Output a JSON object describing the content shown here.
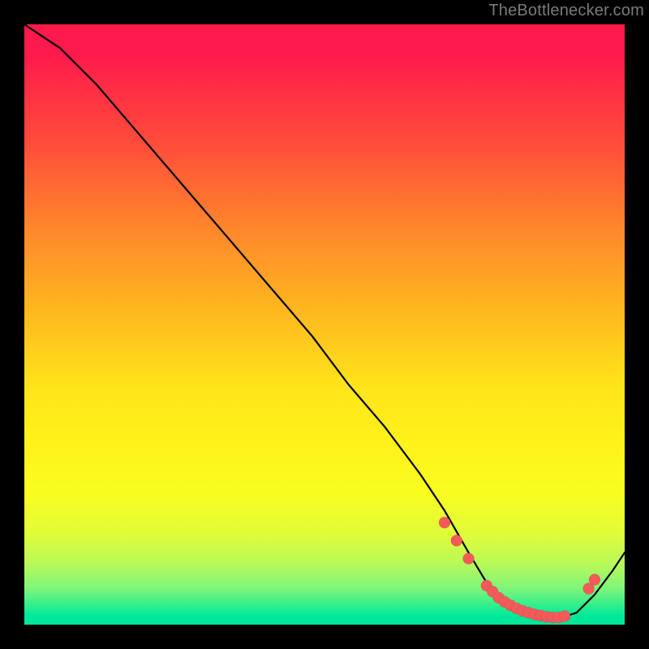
{
  "attribution": "TheBottlenecker.com",
  "chart_data": {
    "type": "line",
    "title": "",
    "xlabel": "",
    "ylabel": "",
    "xlim": [
      0,
      100
    ],
    "ylim": [
      0,
      100
    ],
    "x": [
      0,
      6,
      12,
      18,
      24,
      30,
      36,
      42,
      48,
      54,
      60,
      66,
      70,
      74,
      77,
      80,
      83,
      86,
      89,
      92,
      95,
      98,
      100
    ],
    "values": [
      100,
      96,
      90,
      83,
      76,
      69,
      62,
      55,
      48,
      40,
      33,
      25,
      19,
      12,
      7,
      4,
      2,
      1,
      1,
      2,
      5,
      9,
      12
    ],
    "markers": {
      "x": [
        70,
        72,
        74,
        77,
        78,
        79,
        80,
        81,
        82,
        83,
        84,
        85,
        86,
        87,
        88,
        89,
        90,
        94,
        95
      ],
      "y": [
        17,
        14,
        11,
        6.5,
        5.5,
        4.5,
        3.8,
        3.2,
        2.7,
        2.3,
        2.0,
        1.7,
        1.5,
        1.3,
        1.2,
        1.2,
        1.4,
        6.0,
        7.5
      ]
    }
  }
}
